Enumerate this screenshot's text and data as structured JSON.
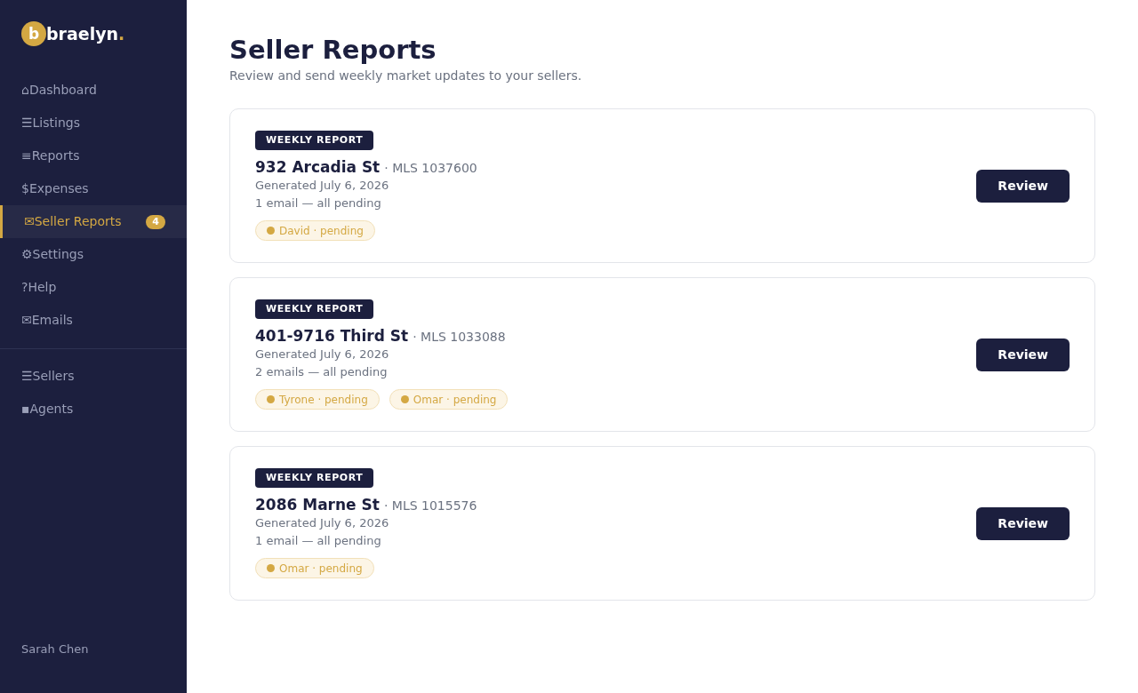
{
  "sidebar": {
    "logo": {
      "mark": "b",
      "name": "braelyn",
      "dot": "."
    },
    "nav": [
      {
        "icon": "⌂",
        "label": "Dashboard",
        "selected": false
      },
      {
        "icon": "☰",
        "label": "Listings",
        "selected": false
      },
      {
        "icon": "≡",
        "label": "Reports",
        "selected": false
      },
      {
        "icon": "$",
        "label": "Expenses",
        "selected": false
      },
      {
        "icon": "✉",
        "label": "Seller Reports",
        "selected": true,
        "badge": "4"
      },
      {
        "icon": "⚙",
        "label": "Settings",
        "selected": false
      },
      {
        "icon": "?",
        "label": "Help",
        "selected": false
      },
      {
        "icon": "✉",
        "label": "Emails",
        "selected": false
      }
    ],
    "secondary_nav": [
      {
        "icon": "☰",
        "label": "Sellers",
        "selected": false
      },
      {
        "icon": "▪",
        "label": "Agents",
        "selected": false
      }
    ],
    "user": "Sarah Chen"
  },
  "page": {
    "title": "Seller Reports",
    "subtitle": "Review and send weekly market updates to your sellers."
  },
  "reports": [
    {
      "tag": "WEEKLY REPORT",
      "address": "932 Arcadia St",
      "mls": "· MLS 1037600",
      "generated": "Generated July 6, 2026",
      "summary": "1 email — all pending",
      "recipients": [
        {
          "label": "David · pending"
        }
      ],
      "action": "Review"
    },
    {
      "tag": "WEEKLY REPORT",
      "address": "401-9716 Third St",
      "mls": "· MLS 1033088",
      "generated": "Generated July 6, 2026",
      "summary": "2 emails — all pending",
      "recipients": [
        {
          "label": "Tyrone · pending"
        },
        {
          "label": "Omar · pending"
        }
      ],
      "action": "Review"
    },
    {
      "tag": "WEEKLY REPORT",
      "address": "2086 Marne St",
      "mls": "· MLS 1015576",
      "generated": "Generated July 6, 2026",
      "summary": "1 email — all pending",
      "recipients": [
        {
          "label": "Omar · pending"
        }
      ],
      "action": "Review"
    }
  ]
}
